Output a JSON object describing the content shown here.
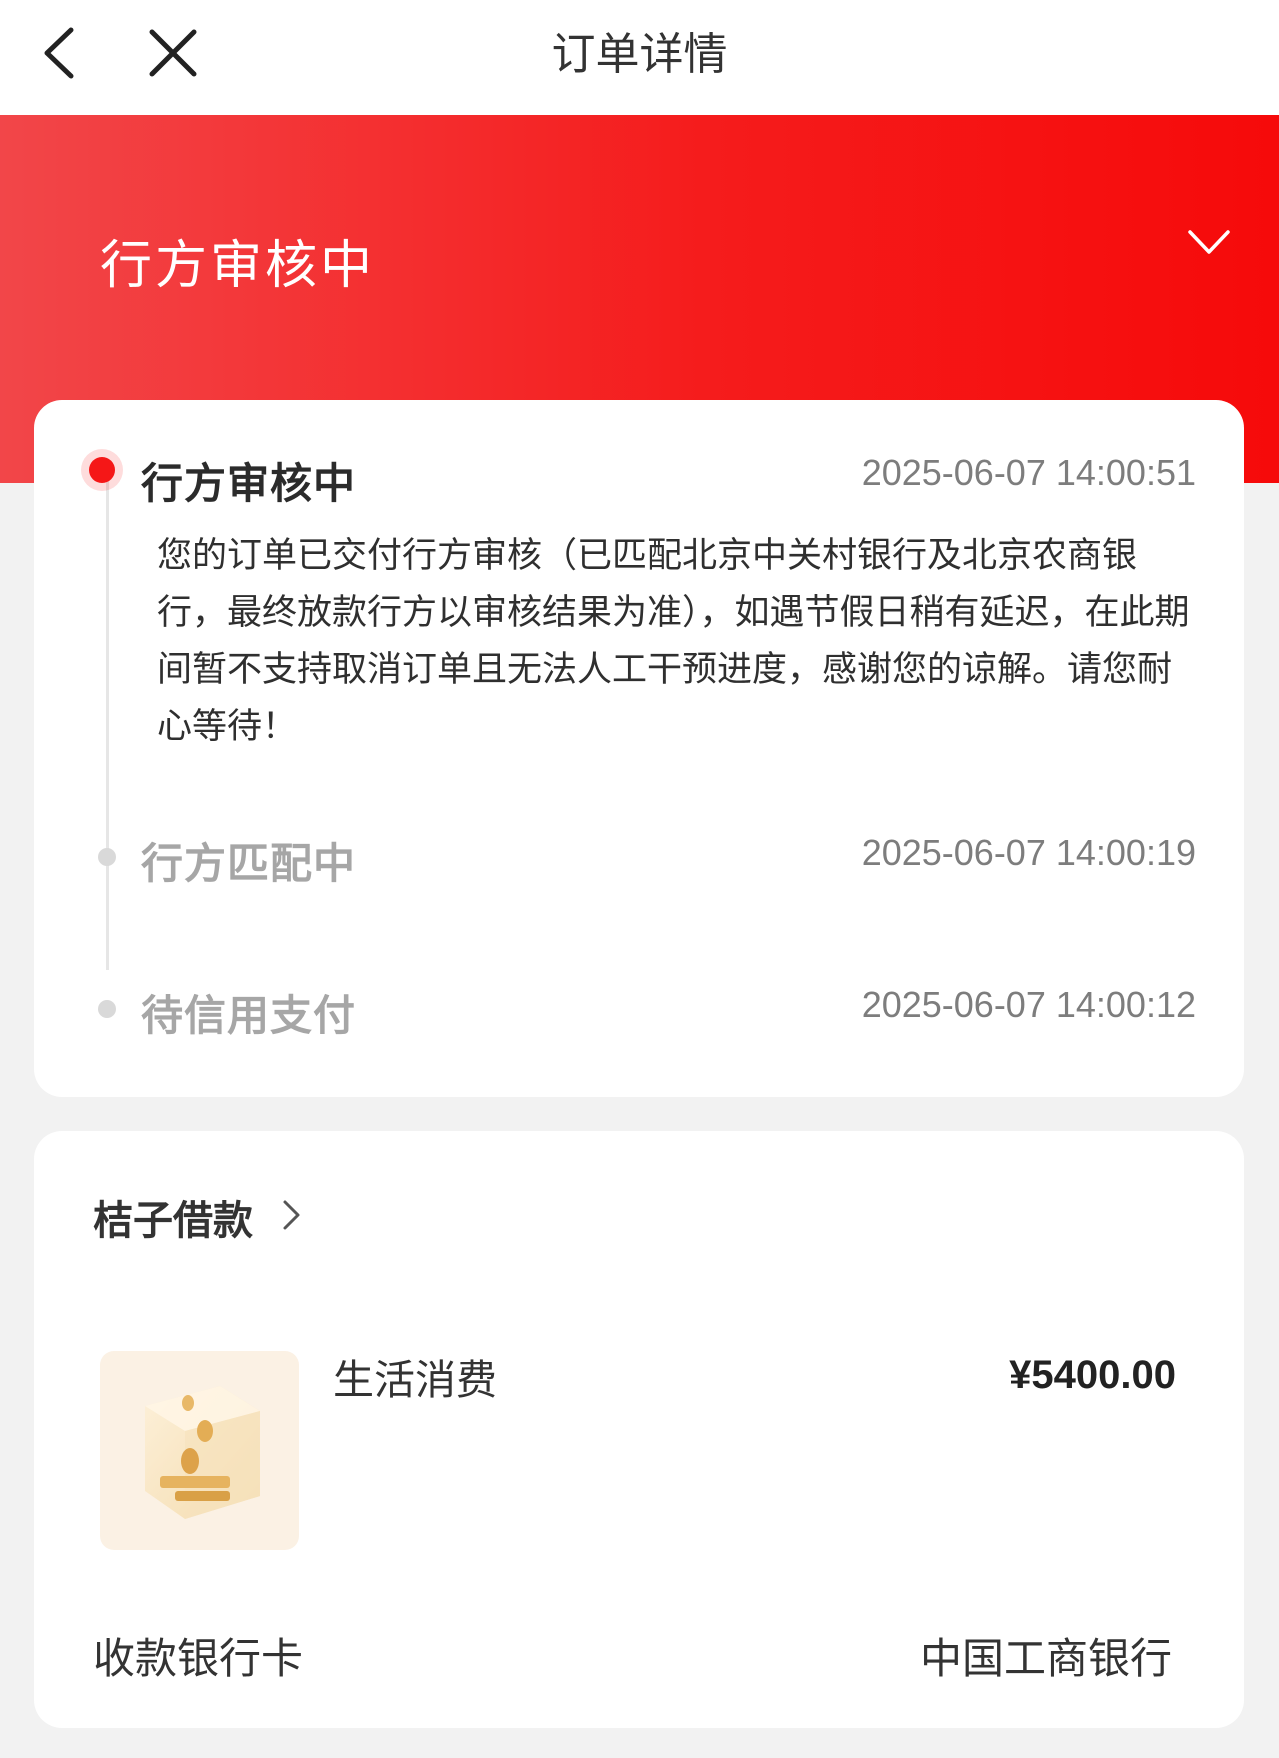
{
  "nav": {
    "title": "订单详情",
    "back_icon": "back-arrow-icon",
    "close_icon": "close-icon"
  },
  "hero": {
    "status_title": "行方审核中",
    "expand_icon": "chevron-down-icon"
  },
  "timeline": {
    "steps": [
      {
        "title": "行方审核中",
        "time": "2025-06-07 14:00:51",
        "desc": "您的订单已交付行方审核（已匹配北京中关村银行及北京农商银行，最终放款行方以审核结果为准），如遇节假日稍有延迟，在此期间暂不支持取消订单且无法人工干预进度，感谢您的谅解。请您耐心等待！"
      },
      {
        "title": "行方匹配中",
        "time": "2025-06-07 14:00:19"
      },
      {
        "title": "待信用支付",
        "time": "2025-06-07 14:00:12"
      }
    ]
  },
  "loan": {
    "product_name": "桔子借款",
    "purpose": "生活消费",
    "amount": "¥5400.00",
    "bank_label": "收款银行卡",
    "bank_name": "中国工商银行",
    "thumb_icon": "coin-box-icon"
  },
  "colors": {
    "brand_red": "#f51717",
    "background": "#f2f2f2"
  }
}
